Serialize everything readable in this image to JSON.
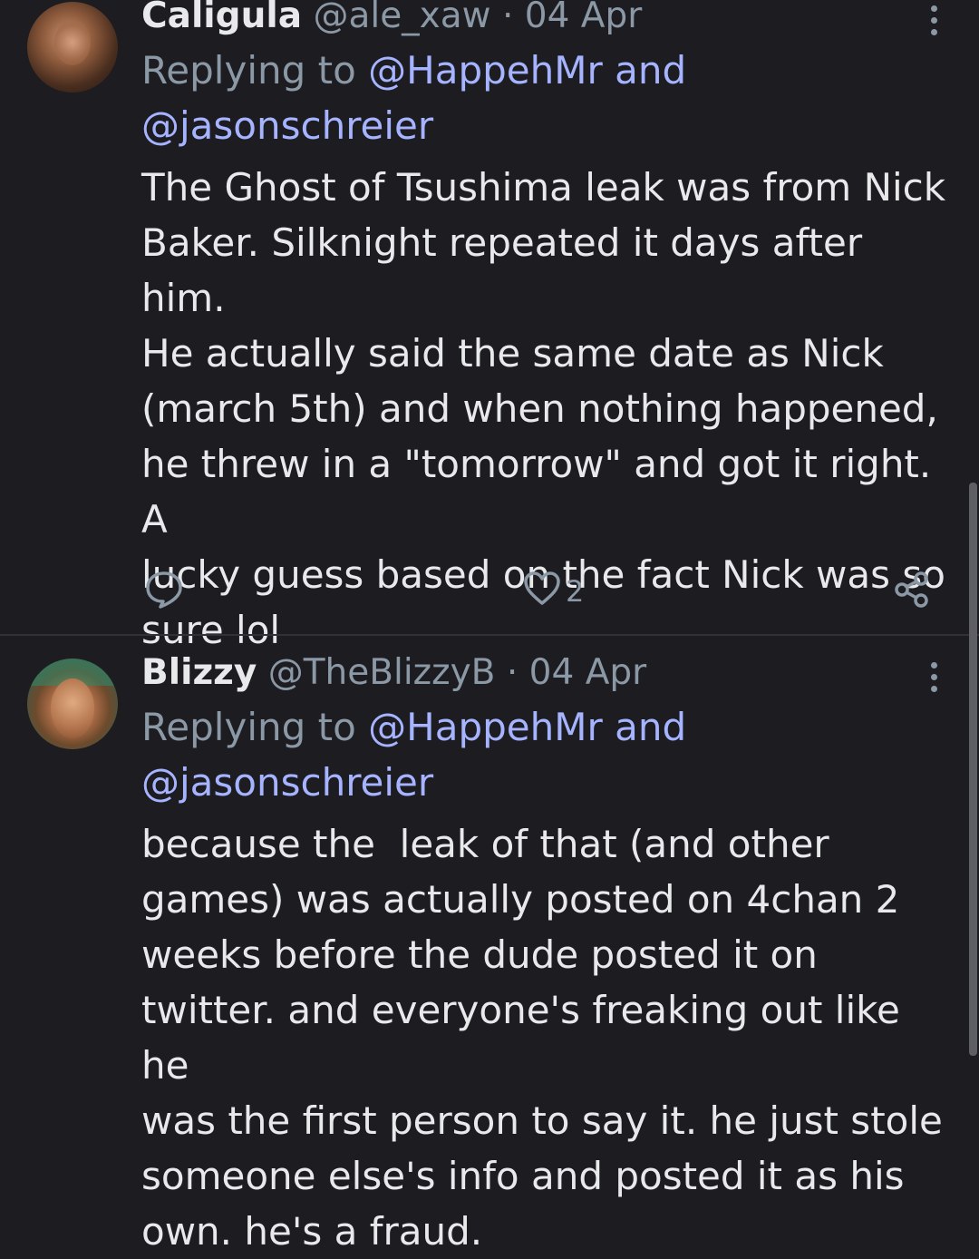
{
  "tweets": [
    {
      "name": "Caligula",
      "handle": "@ale_xaw",
      "separator": "·",
      "date": "04 Apr",
      "replying_prefix": "Replying to",
      "reply_mention_1": "@HappehMr",
      "reply_conjunction": "and",
      "reply_mention_2": "@jasonschreier",
      "text": "The Ghost of Tsushima leak was from Nick\nBaker. Silknight repeated it days after him.\nHe actually said the same date as Nick\n(march 5th) and when nothing happened,\nhe threw in a \"tomorrow\" and got it right. A\nlucky guess based on the fact Nick was so\nsure lol",
      "like_count": "2",
      "icons": {
        "reply": "reply-icon",
        "like": "heart-icon",
        "share": "share-icon",
        "more": "more-vertical-icon"
      }
    },
    {
      "name": "Blizzy",
      "handle": "@TheBlizzyB",
      "separator": "·",
      "date": "04 Apr",
      "replying_prefix": "Replying to",
      "reply_mention_1": "@HappehMr",
      "reply_conjunction": "and",
      "reply_mention_2": "@jasonschreier",
      "text": "because the  leak of that (and other\ngames) was actually posted on 4chan 2\nweeks before the dude posted it on\ntwitter. and everyone's freaking out like he\nwas the first person to say it. he just stole\nsomeone else's info and posted it as his\nown. he's a fraud.",
      "icons": {
        "more": "more-vertical-icon"
      }
    }
  ],
  "colors": {
    "background": "#1c1c21",
    "text": "#e7e9ea",
    "secondary": "#8b98a5",
    "mention": "#a6b4ff",
    "divider": "#2f3336"
  }
}
